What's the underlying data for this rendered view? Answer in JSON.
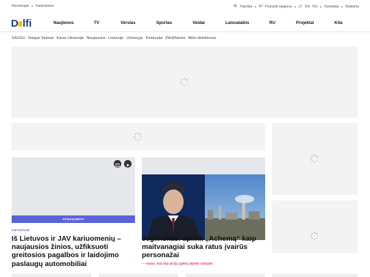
{
  "topbar": {
    "left": [
      "Horoskopai",
      "Kalendorius"
    ],
    "search": "Paieška",
    "report": "Pranešti naujieną",
    "langs": [
      "LT",
      "EN",
      "RU"
    ],
    "contacts": "Kontaktai",
    "ads": "Reklama"
  },
  "logo": {
    "text": "Delfi"
  },
  "nav": [
    "Naujienos",
    "TV",
    "Verslas",
    "Sportas",
    "Veidai",
    "Laisvalaikis",
    "RU",
    "Projektai",
    "Kita"
  ],
  "subnav": [
    "SAUGU",
    "Naujas Seimas",
    "Karas Ukrainoje",
    "Naujausios",
    "Lietuvoje",
    "Užsienyje",
    "Kriminalai",
    "(Ne)Matomi",
    "Melo detektorius"
  ],
  "articles": [
    {
      "badge": "ATNAUJINTA",
      "tag": "LIETUVOJE",
      "title": "Iš Lietuvos ir JAV kariuomenių – naujausios žinios, užfiksuoti greitosios pagalbos ir laidojimo paslaugų automobiliai"
    },
    {
      "title": "Jeglinskas: aplink „Achemą“ kaip maitvanagiai suka ratus įvairūs personažai",
      "subtitle": "— mano, kad dalį akcijų galėtų išpirkti valstybė"
    }
  ],
  "colors": {
    "accent": "#5b63d9",
    "brand_blue": "#1d3c8f",
    "brand_yellow": "#f5c400",
    "pink": "#d1145a"
  }
}
